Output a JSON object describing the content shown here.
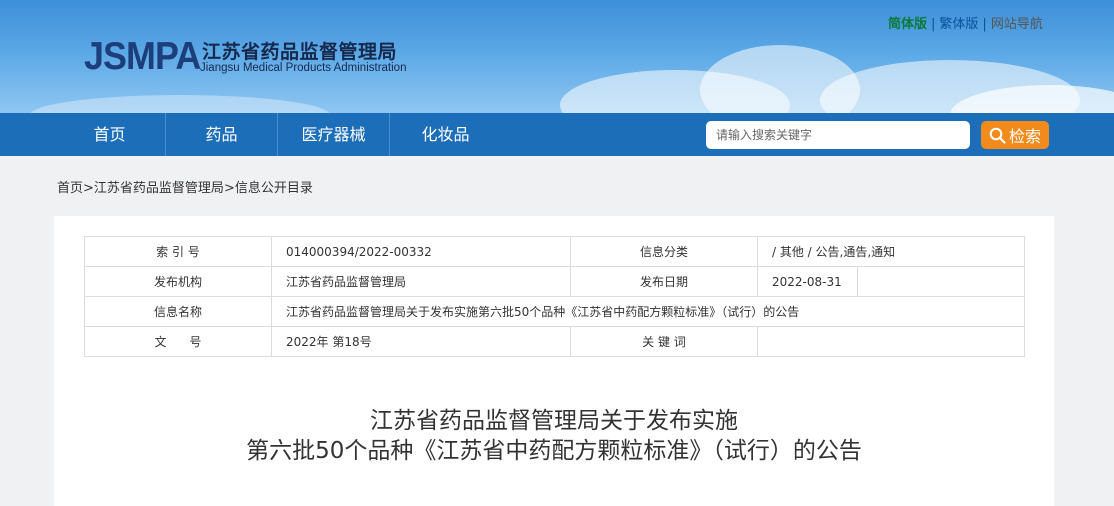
{
  "header": {
    "logo_abbr": "JSMPA",
    "org_name_cn": "江苏省药品监督管理局",
    "org_name_en": "Jiangsu Medical Products Administration",
    "lang_simplified": "简体版",
    "lang_separator": "|",
    "lang_traditional": "繁体版",
    "site_nav": "网站导航"
  },
  "nav": {
    "items": [
      "首页",
      "药品",
      "医疗器械",
      "化妆品"
    ],
    "search_placeholder": "请输入搜索关键字",
    "search_button": "检索"
  },
  "breadcrumb": {
    "items": [
      "首页",
      "江苏省药品监督管理局",
      "信息公开目录"
    ],
    "separator": ">"
  },
  "info_table": {
    "index_label": "索 引 号",
    "index_value": "014000394/2022-00332",
    "category_label": "信息分类",
    "category_value": "/  其他  /  公告,通告,通知",
    "publisher_label": "发布机构",
    "publisher_value": "江苏省药品监督管理局",
    "date_label": "发布日期",
    "date_value": "2022-08-31",
    "name_label": "信息名称",
    "name_value": "江苏省药品监督管理局关于发布实施第六批50个品种《江苏省中药配方颗粒标准》（试行）的公告",
    "doc_no_label": "文      号",
    "doc_no_value": "2022年 第18号",
    "keywords_label": "关 键 词",
    "keywords_value": ""
  },
  "article": {
    "title_line1": "江苏省药品监督管理局关于发布实施",
    "title_line2": "第六批50个品种《江苏省中药配方颗粒标准》（试行）的公告"
  }
}
